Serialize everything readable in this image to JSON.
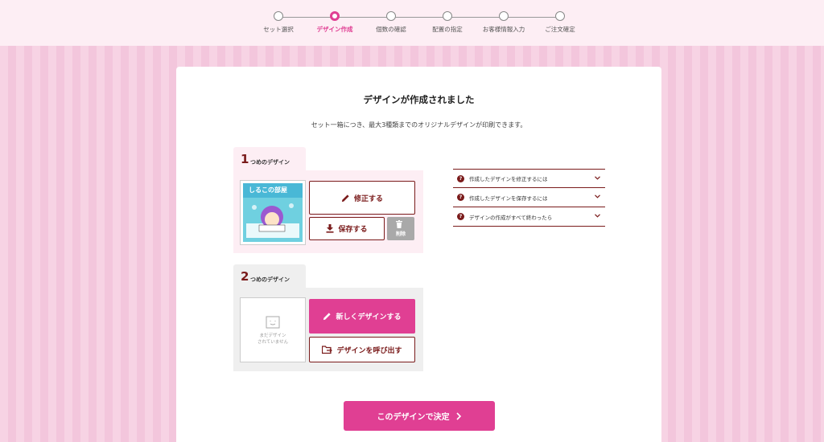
{
  "steps": [
    {
      "label": "セット選択",
      "active": false
    },
    {
      "label": "デザイン作成",
      "active": true
    },
    {
      "label": "個数の確認",
      "active": false
    },
    {
      "label": "配置の指定",
      "active": false
    },
    {
      "label": "お客様情報入力",
      "active": false
    },
    {
      "label": "ご注文確定",
      "active": false
    }
  ],
  "main": {
    "title": "デザインが作成されました",
    "subtitle": "セット一箱につき、最大3種類までのオリジナルデザインが印刷できます。"
  },
  "design1": {
    "number": "1",
    "tab_label": "つめのデザイン",
    "thumb_text": "しるこの部屋",
    "edit_label": "修正する",
    "save_label": "保存する",
    "delete_label": "削除"
  },
  "design2": {
    "number": "2",
    "tab_label": "つめのデザイン",
    "empty_line1": "まだデザイン",
    "empty_line2": "されていません",
    "new_label": "新しくデザインする",
    "load_label": "デザインを呼び出す"
  },
  "faq": [
    {
      "mark": "?",
      "text": "作成したデザインを修正するには"
    },
    {
      "mark": "?",
      "text": "作成したデザインを保存するには"
    },
    {
      "mark": "?",
      "text": "デザインの作成がすべて終わったら"
    }
  ],
  "decide_label": "このデザインで決定",
  "colors": {
    "accent": "#e03f93",
    "brand_dark": "#7a1b1b",
    "panel1_bg": "#fdeef4",
    "panel2_bg": "#efefef"
  }
}
